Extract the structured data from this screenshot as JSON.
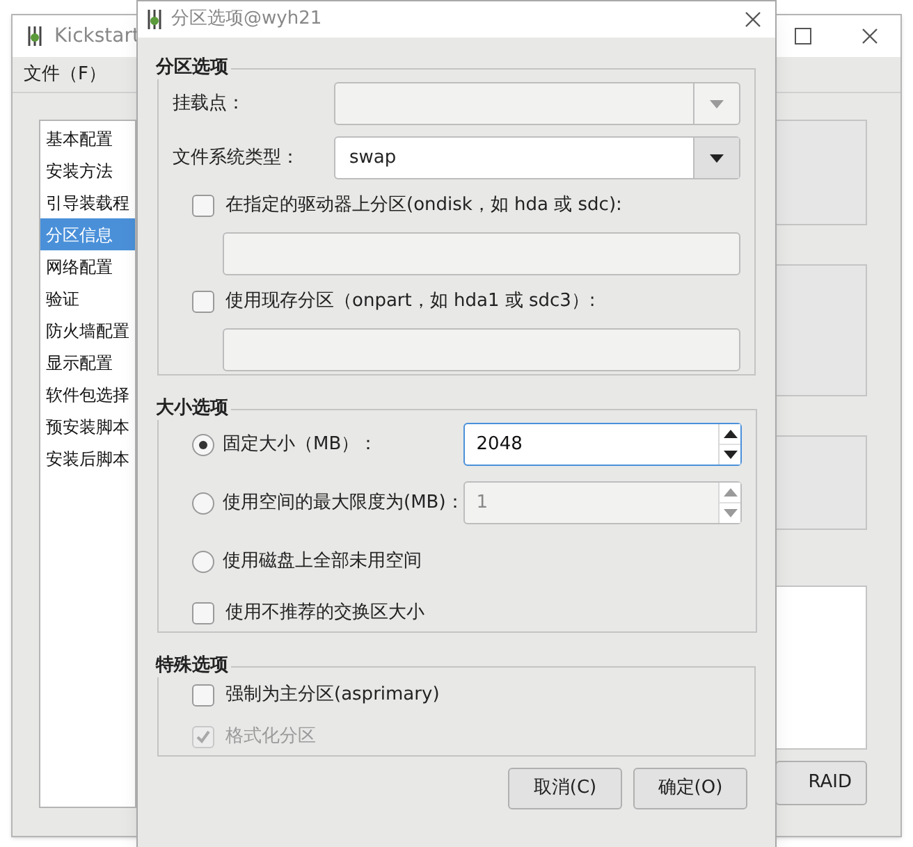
{
  "main_window": {
    "title": "Kickstart",
    "menu": [
      "文件（F）"
    ],
    "sidebar": {
      "items": [
        {
          "label": "基本配置",
          "selected": false
        },
        {
          "label": "安装方法",
          "selected": false
        },
        {
          "label": "引导装载程",
          "selected": false
        },
        {
          "label": "分区信息",
          "selected": true
        },
        {
          "label": "网络配置",
          "selected": false
        },
        {
          "label": "验证",
          "selected": false
        },
        {
          "label": "防火墙配置",
          "selected": false
        },
        {
          "label": "显示配置",
          "selected": false
        },
        {
          "label": "软件包选择",
          "selected": false
        },
        {
          "label": "预安装脚本",
          "selected": false
        },
        {
          "label": "安装后脚本",
          "selected": false
        }
      ]
    },
    "raid_button": "RAID"
  },
  "dialog": {
    "title": "分区选项@wyh21",
    "sections": [
      {
        "title": "分区选项",
        "rows": [
          {
            "kind": "combo",
            "label": "挂载点：",
            "disabled": true
          },
          {
            "kind": "combo",
            "label": "文件系统类型：",
            "value": "swap",
            "disabled": false
          },
          {
            "kind": "checkbox",
            "label": "在指定的驱动器上分区(ondisk，如 hda 或 sdc):",
            "checked": false,
            "disabled": false
          },
          {
            "kind": "field",
            "disabled": true
          },
          {
            "kind": "checkbox",
            "label": "使用现存分区（onpart，如 hda1 或 sdc3）:",
            "checked": false,
            "disabled": false
          },
          {
            "kind": "field",
            "disabled": true
          }
        ]
      },
      {
        "title": "大小选项",
        "rows": [
          {
            "kind": "radio",
            "label": "固定大小（MB）：",
            "selected": true,
            "spin": {
              "value": "2048",
              "disabled": false,
              "focused": true
            }
          },
          {
            "kind": "radio",
            "label": "使用空间的最大限度为(MB)：",
            "selected": false,
            "spin": {
              "value": "1",
              "disabled": true,
              "focused": false
            }
          },
          {
            "kind": "radio",
            "label": "使用磁盘上全部未用空间",
            "selected": false
          },
          {
            "kind": "checkbox",
            "label": "使用不推荐的交换区大小",
            "checked": false,
            "disabled": false
          }
        ]
      },
      {
        "title": "特殊选项",
        "rows": [
          {
            "kind": "checkbox",
            "label": "强制为主分区(asprimary)",
            "checked": false,
            "disabled": false
          },
          {
            "kind": "checkbox",
            "label": "格式化分区",
            "checked": true,
            "disabled": true
          }
        ]
      }
    ],
    "buttons": [
      "取消(C)",
      "确定(O)"
    ]
  }
}
